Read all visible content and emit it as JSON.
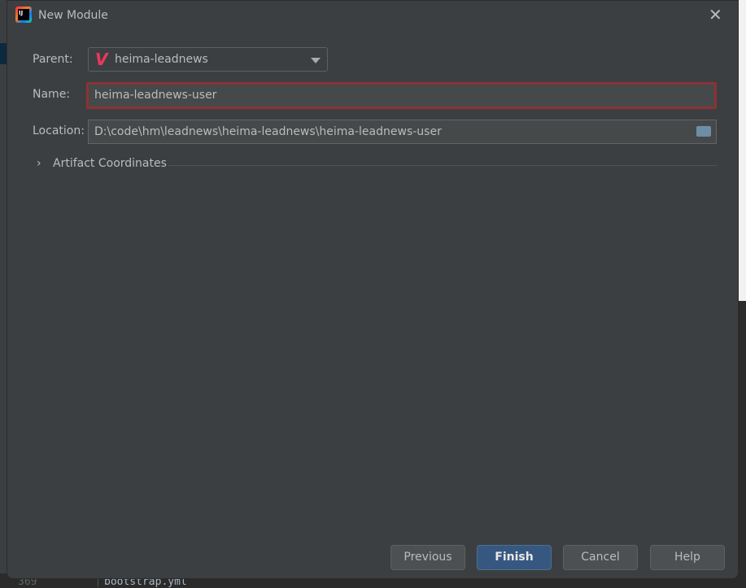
{
  "dialog": {
    "title": "New Module",
    "close_icon": "close-icon"
  },
  "form": {
    "parent_label": "Parent:",
    "parent_value": "heima-leadnews",
    "name_label": "Name:",
    "name_value": "heima-leadnews-user",
    "location_label": "Location:",
    "location_value": "D:\\code\\hm\\leadnews\\heima-leadnews\\heima-leadnews-user",
    "artifact_label": "Artifact Coordinates"
  },
  "buttons": {
    "previous": "Previous",
    "finish": "Finish",
    "cancel": "Cancel",
    "help": "Help"
  },
  "background_editor": {
    "line_number": "369",
    "code": "bootstrap.yml"
  },
  "colors": {
    "error_border": "#8c3235",
    "primary_button": "#365880",
    "maven_icon": "#f0365b"
  }
}
